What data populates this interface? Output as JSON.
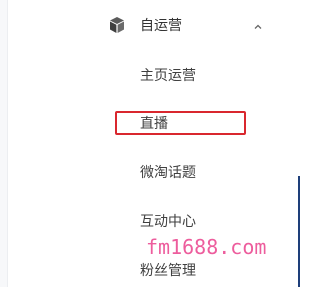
{
  "sidebar": {
    "group": {
      "title": "自运营",
      "icon": "cube-icon",
      "expanded": true,
      "chevron": "chevron-up-icon"
    },
    "items": [
      {
        "label": "主页运营"
      },
      {
        "label": "直播",
        "highlighted": true
      },
      {
        "label": "微淘话题"
      },
      {
        "label": "互动中心"
      },
      {
        "label": "粉丝管理"
      }
    ]
  },
  "watermark": {
    "text": "fm1688.com"
  },
  "colors": {
    "highlight_border": "#d9272e",
    "watermark": "#ed5d9d",
    "text": "#333333",
    "edge_bar": "#1e3f7a"
  }
}
